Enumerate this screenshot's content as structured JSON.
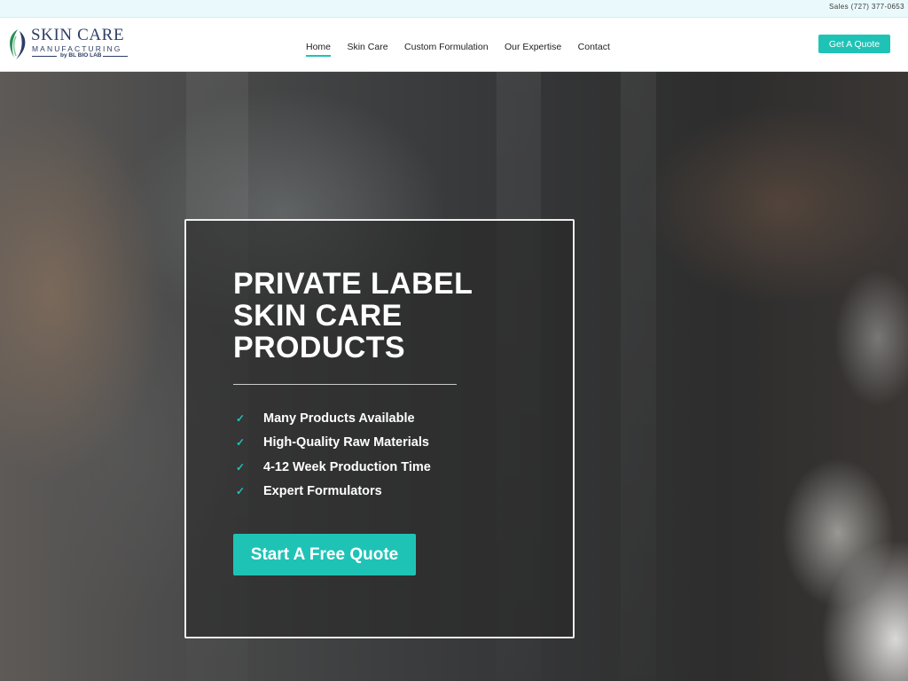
{
  "topbar": {
    "phone": "Sales (727) 377-0653"
  },
  "logo": {
    "line1": "SKIN CARE",
    "line2": "MANUFACTURING",
    "line3": "by BL BIO LAB"
  },
  "nav": {
    "items": [
      {
        "label": "Home",
        "active": true
      },
      {
        "label": "Skin Care",
        "active": false
      },
      {
        "label": "Custom Formulation",
        "active": false
      },
      {
        "label": "Our Expertise",
        "active": false
      },
      {
        "label": "Contact",
        "active": false
      }
    ]
  },
  "header": {
    "cta_label": "Get A Quote"
  },
  "hero": {
    "title": "PRIVATE LABEL\nSKIN CARE\nPRODUCTS",
    "features": [
      "Many Products Available",
      "High-Quality Raw Materials",
      "4-12 Week Production Time",
      "Expert Formulators"
    ],
    "check_icon": "check-icon",
    "cta_label": "Start A Free Quote"
  },
  "colors": {
    "accent": "#1fc3b6",
    "brand_navy": "#2c3e66",
    "topbar_bg": "#eaf9fb"
  }
}
